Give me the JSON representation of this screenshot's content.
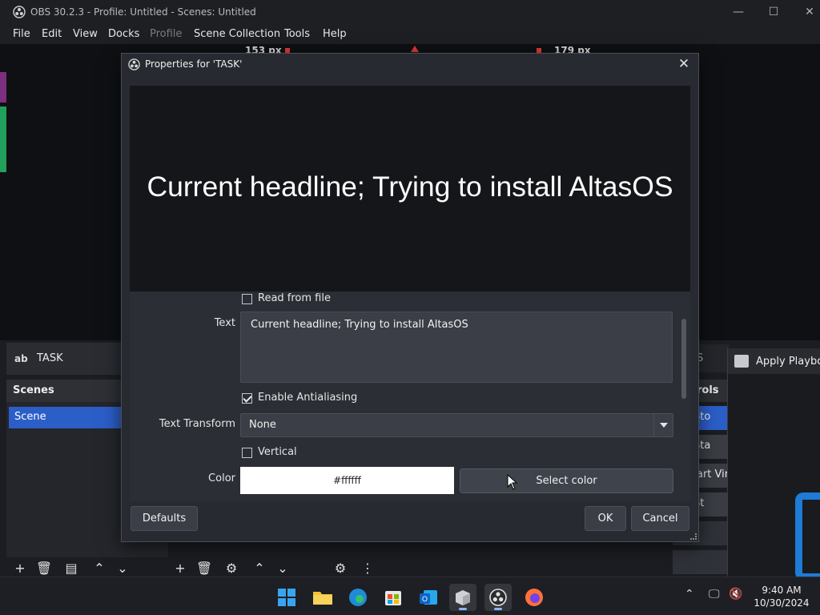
{
  "window": {
    "title": "OBS 30.2.3 - Profile: Untitled - Scenes: Untitled",
    "minimize": "—",
    "maximize": "☐",
    "close": "✕"
  },
  "menu": [
    "File",
    "Edit",
    "View",
    "Docks",
    "Profile",
    "Scene Collection",
    "Tools",
    "Help"
  ],
  "preview": {
    "ruler_left": "153 px",
    "ruler_right": "179 px"
  },
  "source_bar": {
    "icon": "ab",
    "name": "TASK"
  },
  "scenes_dock": {
    "header": "Scenes",
    "items": [
      "Scene"
    ]
  },
  "controls_dock": {
    "header_fragment": "rols",
    "sources_fragment": "S",
    "buttons": [
      "Sto",
      "Sta",
      "art Virt",
      "St"
    ]
  },
  "dialog": {
    "title": "Properties for 'TASK'",
    "preview_text": "Current headline; Trying to install AltasOS",
    "read_from_file_label": "Read from file",
    "text_label": "Text",
    "text_value": "Current headline; Trying to install AltasOS",
    "antialiasing_label": "Enable Antialiasing",
    "antialiasing_checked": true,
    "text_transform_label": "Text Transform",
    "text_transform_value": "None",
    "vertical_label": "Vertical",
    "vertical_checked": false,
    "color_label": "Color",
    "color_value": "#ffffff",
    "select_color_label": "Select color",
    "defaults_label": "Defaults",
    "ok_label": "OK",
    "cancel_label": "Cancel"
  },
  "playbook_window": {
    "title": "Apply Playbook"
  },
  "taskbar": {
    "apps": [
      "start-icon",
      "file-explorer-icon",
      "edge-icon",
      "store-icon",
      "outlook-icon",
      "playbook-app-icon",
      "obs-icon",
      "firefox-icon"
    ],
    "time": "9:40 AM",
    "date": "10/30/2024"
  },
  "colors": {
    "accent": "#2c5ec8",
    "dialog_bg": "#272a31",
    "text_color_swatch": "#ffffff"
  }
}
